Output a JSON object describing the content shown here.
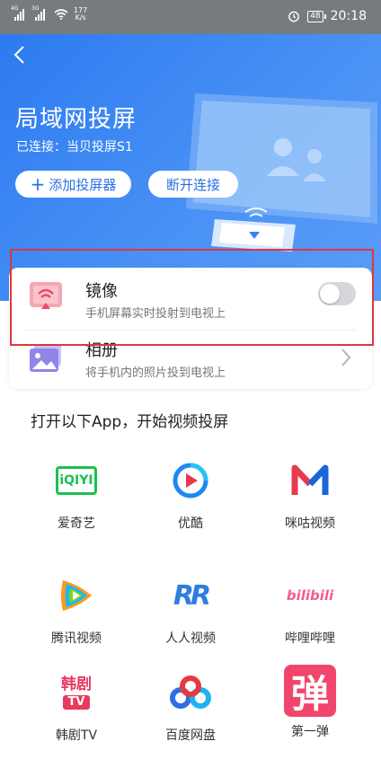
{
  "status_bar": {
    "sim1": "4G",
    "sim2": "3G",
    "speed_value": "177",
    "speed_unit": "K/s",
    "battery": "48",
    "time": "20:18"
  },
  "header": {
    "title": "局域网投屏",
    "connection_status": "已连接：当贝投屏S1",
    "add_label": "添加投屏器",
    "disconnect_label": "断开连接"
  },
  "options": [
    {
      "title": "镜像",
      "desc": "手机屏幕实时投射到电视上",
      "enabled": false
    },
    {
      "title": "相册",
      "desc": "将手机内的照片投到电视上"
    }
  ],
  "apps_section": {
    "title": "打开以下App，开始视频投屏",
    "apps": [
      {
        "name": "爱奇艺",
        "logo_text": "iQIYI",
        "icon": "iqiyi-icon"
      },
      {
        "name": "优酷",
        "logo_text": "",
        "icon": "youku-icon"
      },
      {
        "name": "咪咕视频",
        "logo_text": "M",
        "icon": "migu-icon"
      },
      {
        "name": "腾讯视频",
        "logo_text": "",
        "icon": "tencent-video-icon"
      },
      {
        "name": "人人视频",
        "logo_text": "RR",
        "icon": "renren-icon"
      },
      {
        "name": "哔哩哔哩",
        "logo_text": "bilibili",
        "icon": "bilibili-icon"
      },
      {
        "name": "韩剧TV",
        "logo_text": "韩剧",
        "logo_text2": "TV",
        "icon": "hanju-tv-icon"
      },
      {
        "name": "百度网盘",
        "logo_text": "",
        "icon": "baidu-netdisk-icon"
      },
      {
        "name": "第一弹",
        "logo_text": "弹",
        "icon": "diyidan-icon"
      }
    ]
  },
  "colors": {
    "accent": "#2b6fe4",
    "highlight": "#e0353f",
    "status_bar": "#777b80"
  }
}
